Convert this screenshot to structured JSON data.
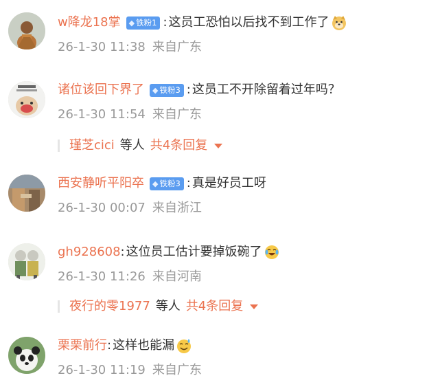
{
  "comments": [
    {
      "username": "w降龙18掌",
      "badge": "铁粉1",
      "separator": ":",
      "text": "这员工恐怕以后找不到工作了",
      "emoji": "doge-emoji",
      "time": "26-1-30 11:38",
      "location": "来自广东"
    },
    {
      "username": "诸位该回下界了",
      "badge": "铁粉3",
      "separator": ":",
      "text": "这员工不开除留着过年吗？",
      "time": "26-1-30 11:54",
      "location": "来自广东",
      "replies": {
        "names": "瑾芝cici",
        "etc": "等人",
        "count": "共4条回复"
      }
    },
    {
      "username": "西安静听平阳卒",
      "badge": "铁粉3",
      "separator": ":",
      "text": "真是好员工呀",
      "time": "26-1-30 00:07",
      "location": "来自浙江"
    },
    {
      "username": "gh928608",
      "separator": ":",
      "text": "这位员工估计要掉饭碗了",
      "emoji": "crying-laughing-emoji",
      "time": "26-1-30 11:26",
      "location": "来自河南",
      "replies": {
        "names": "夜行的零1977",
        "etc": "等人",
        "count": "共4条回复"
      }
    },
    {
      "username": "栗栗前行",
      "separator": ":",
      "text": "这样也能漏",
      "emoji": "sweat-smile-emoji",
      "time": "26-1-30 11:19",
      "location": "来自广东"
    }
  ],
  "colors": {
    "username": "#eb7350",
    "badge": "#5a9cf0",
    "meta": "#999999",
    "text": "#333333"
  }
}
